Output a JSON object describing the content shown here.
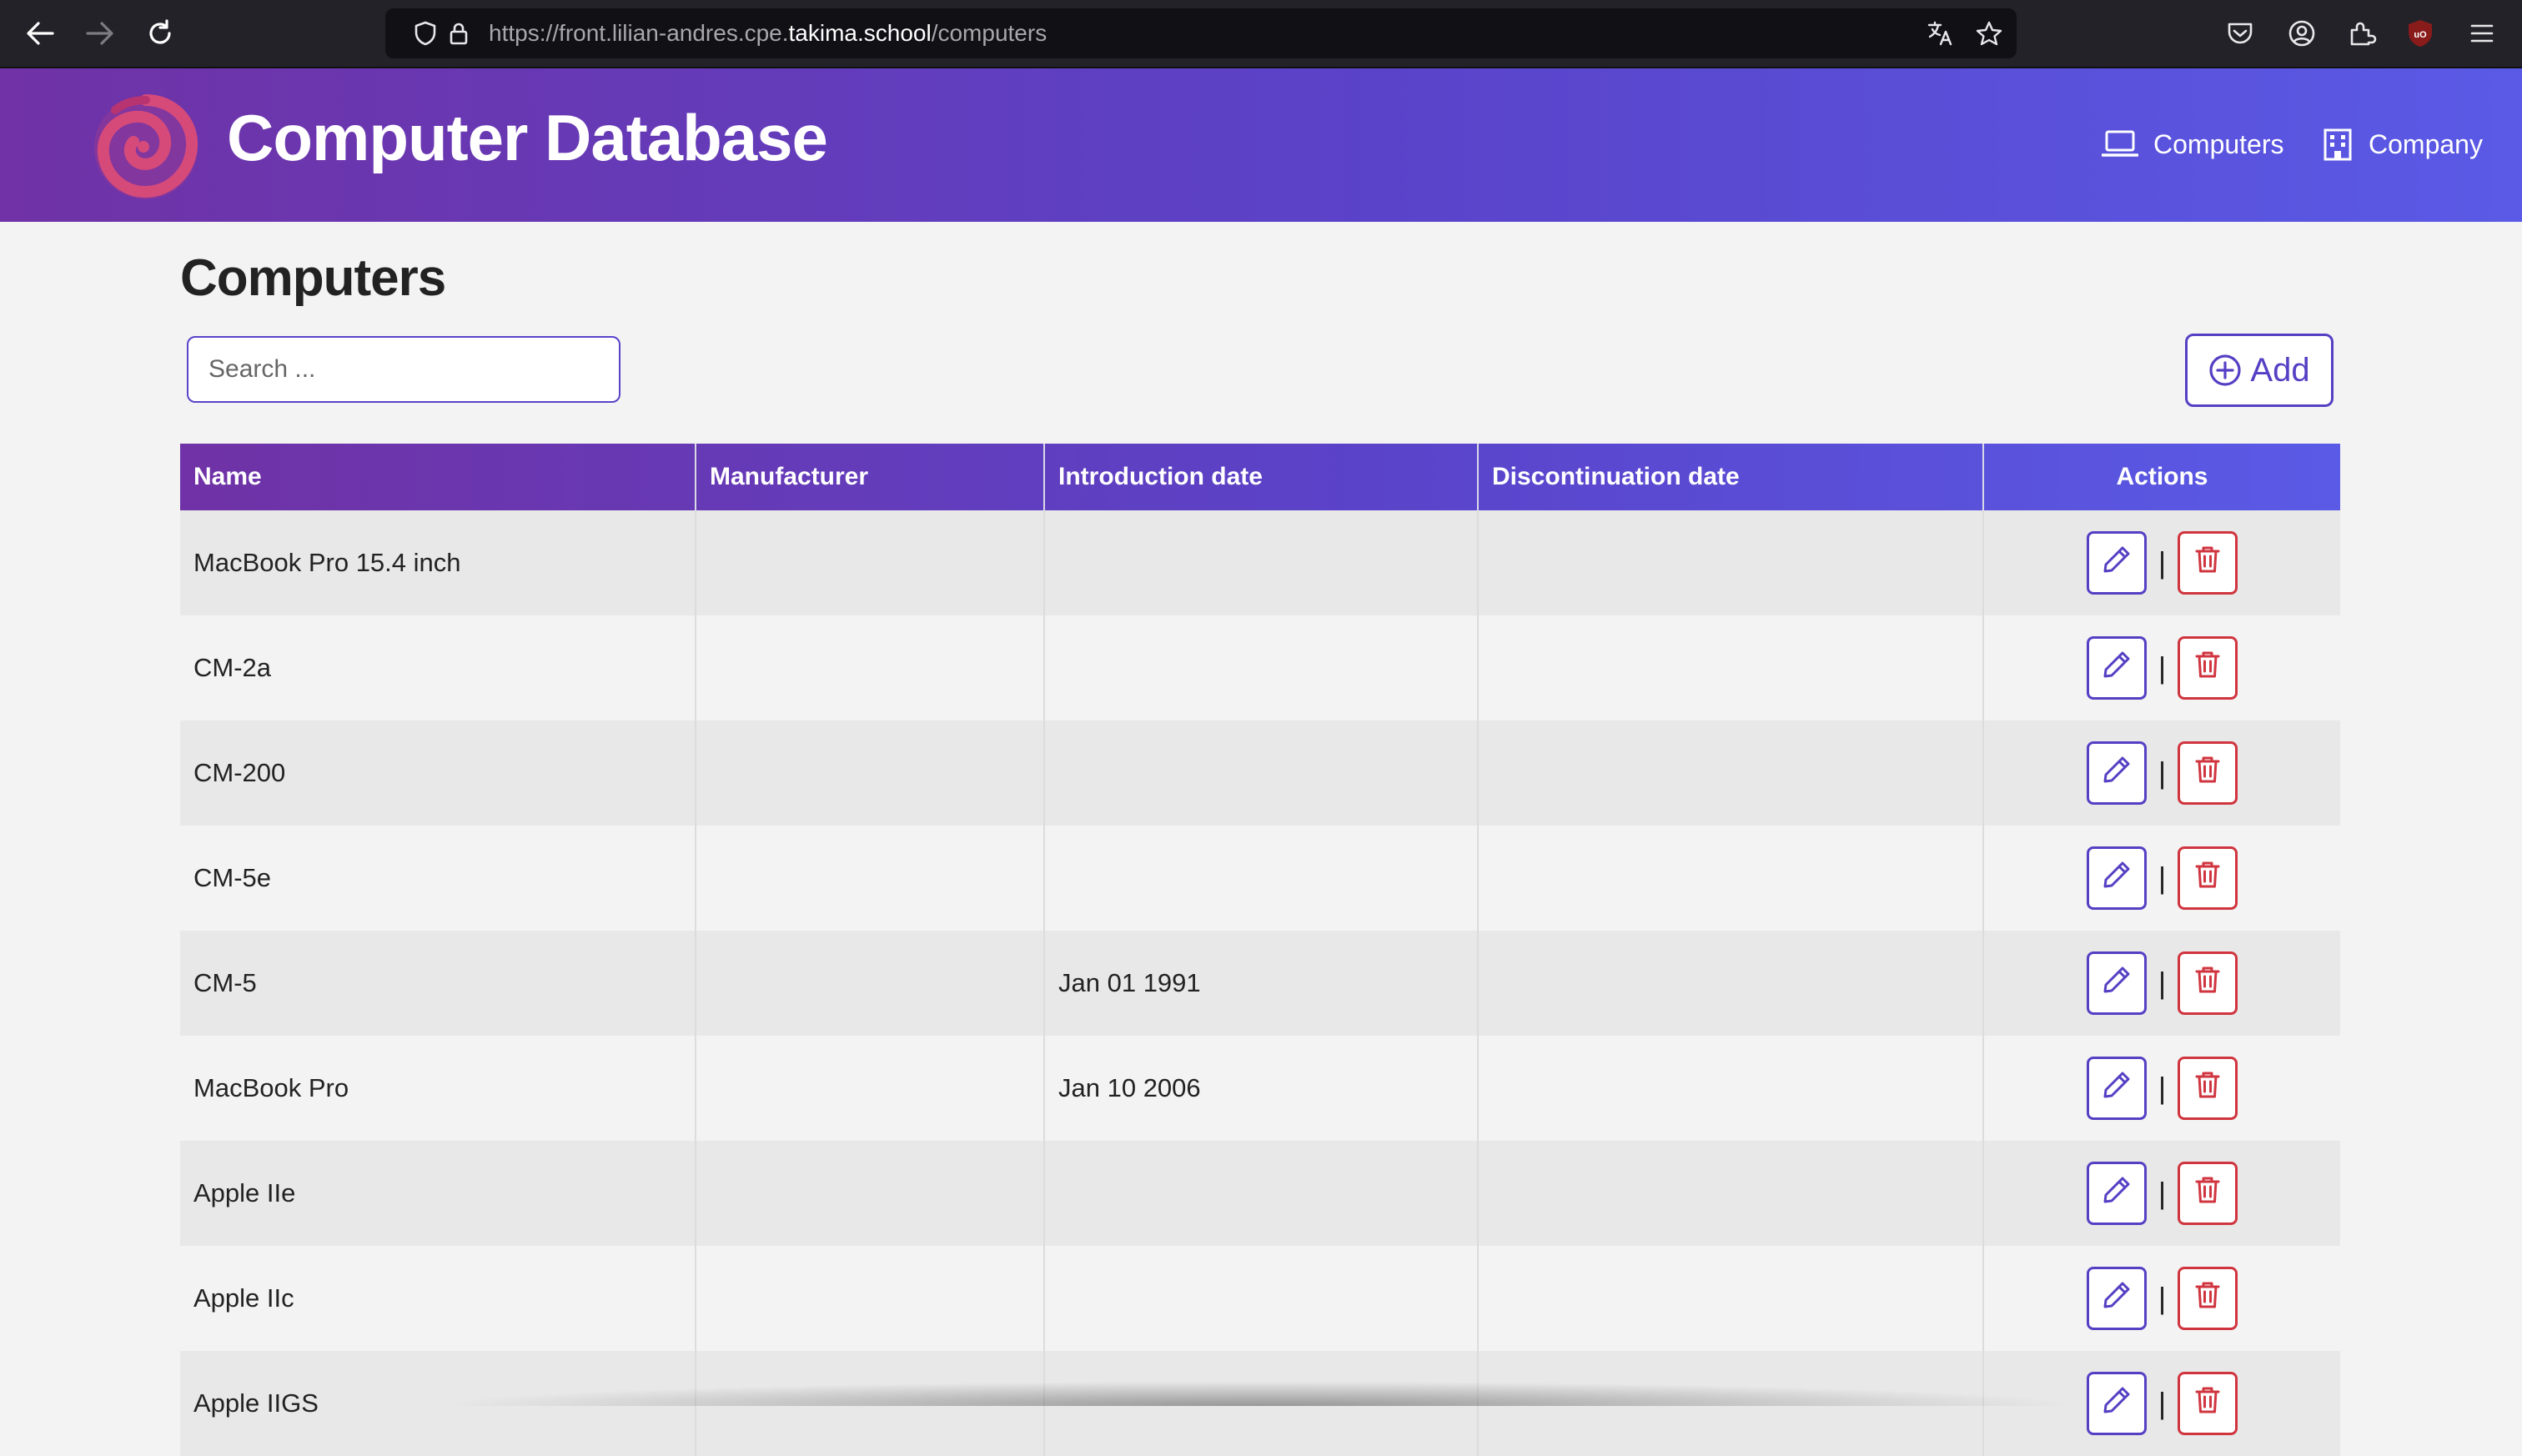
{
  "browser": {
    "url_prefix": "https://front.lilian-andres.cpe.",
    "url_domain": "takima.school",
    "url_suffix": "/computers"
  },
  "header": {
    "title": "Computer Database",
    "nav": [
      {
        "label": "Computers",
        "icon": "laptop-icon"
      },
      {
        "label": "Company",
        "icon": "building-icon"
      }
    ]
  },
  "page": {
    "title": "Computers",
    "search_placeholder": "Search ...",
    "add_label": "Add"
  },
  "table": {
    "columns": [
      "Name",
      "Manufacturer",
      "Introduction date",
      "Discontinuation date",
      "Actions"
    ],
    "separator": "|",
    "rows": [
      {
        "name": "MacBook Pro 15.4 inch",
        "manufacturer": "",
        "introduced": "",
        "discontinued": ""
      },
      {
        "name": "CM-2a",
        "manufacturer": "",
        "introduced": "",
        "discontinued": ""
      },
      {
        "name": "CM-200",
        "manufacturer": "",
        "introduced": "",
        "discontinued": ""
      },
      {
        "name": "CM-5e",
        "manufacturer": "",
        "introduced": "",
        "discontinued": ""
      },
      {
        "name": "CM-5",
        "manufacturer": "",
        "introduced": "Jan 01 1991",
        "discontinued": ""
      },
      {
        "name": "MacBook Pro",
        "manufacturer": "",
        "introduced": "Jan 10 2006",
        "discontinued": ""
      },
      {
        "name": "Apple IIe",
        "manufacturer": "",
        "introduced": "",
        "discontinued": ""
      },
      {
        "name": "Apple IIc",
        "manufacturer": "",
        "introduced": "",
        "discontinued": ""
      },
      {
        "name": "Apple IIGS",
        "manufacturer": "",
        "introduced": "",
        "discontinued": ""
      }
    ]
  },
  "colors": {
    "brand_primary": "#5a43c9",
    "brand_purple": "#7032a6",
    "delete_red": "#d0353f",
    "logo_pink": "#d64a7a"
  }
}
